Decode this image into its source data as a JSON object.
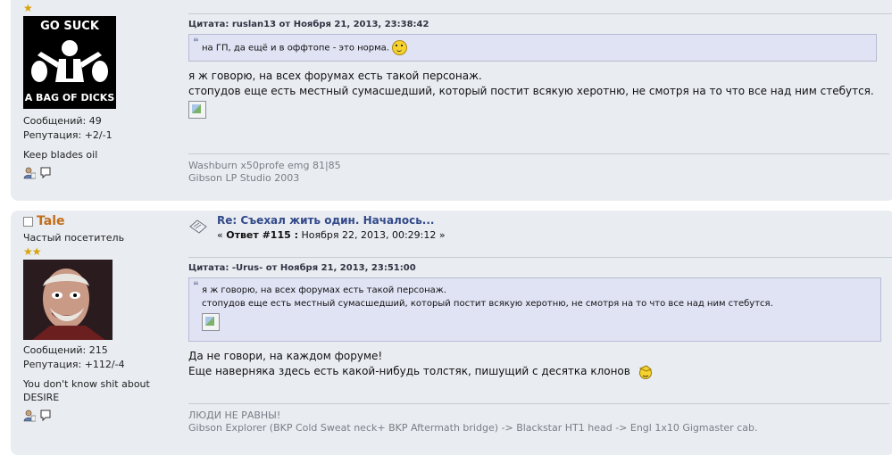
{
  "posts": [
    {
      "author": {
        "stars": "★",
        "avatar_text_top": "GO SUCK",
        "avatar_text_bottom": "A BAG OF DICKS",
        "messages": "Сообщений: 49",
        "reputation": "Репутация: +2/-1",
        "custom_text": "Keep blades oil"
      },
      "quote_header": "Цитата: ruslan13 от Ноября 21, 2013, 23:38:42",
      "quote_text": "на ГП, да ещё и в оффтопе - это норма.",
      "message_lines": [
        "я ж говорю, на всех форумах есть такой персонаж.",
        "стопудов еще есть местный сумасшедший, который постит всякую херотню, не смотря на то что все над ним стебутся."
      ],
      "signature_lines": [
        "Washburn x50profe emg 81|85",
        "Gibson LP Studio 2003"
      ]
    },
    {
      "author": {
        "name": "Tale",
        "rank": "Частый посетитель",
        "stars": "★★",
        "messages": "Сообщений: 215",
        "reputation": "Репутация: +112/-4",
        "custom_text_1": "You don't know shit about",
        "custom_text_2": "DESIRE"
      },
      "title": "Re: Съехал жить один. Началось...",
      "reply_prefix": "« ",
      "reply_label": "Ответ #115 :",
      "reply_date": " Ноября 22, 2013, 00:29:12 »",
      "quote_header": "Цитата: -Urus- от Ноября 21, 2013, 23:51:00",
      "quote_lines": [
        "я ж говорю, на всех форумах есть такой персонаж.",
        "стопудов еще есть местный сумасшедший, который постит всякую херотню, не смотря на то что все над ним стебутся."
      ],
      "message_lines": [
        "Да не говори, на каждом форуме!",
        "Еще наверняка здесь есть какой-нибудь толстяк, пишущий с десятка клонов"
      ],
      "signature_lines": [
        "ЛЮДИ НЕ РАВНЫ!",
        "Gibson Explorer (BKP Cold Sweat neck+ BKP Aftermath bridge) -> Blackstar HT1 head -> Engl 1x10 Gigmaster cab."
      ]
    }
  ],
  "colors": {
    "post_bg": "#e9ecf1",
    "quote_bg": "#e0e3f4",
    "username": "#c26d1a",
    "title": "#334a8a",
    "stars": "#d7a30b"
  }
}
